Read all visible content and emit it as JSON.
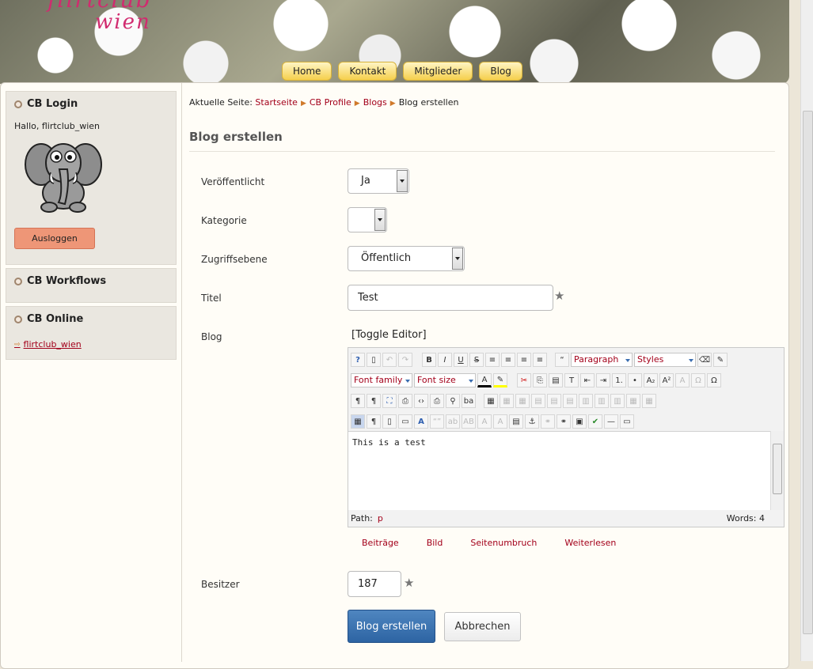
{
  "site": {
    "logo_line1": "flirtclub",
    "logo_line2": "wien"
  },
  "nav": [
    "Home",
    "Kontakt",
    "Mitglieder",
    "Blog"
  ],
  "sidebar": {
    "login_title": "CB Login",
    "greeting": "Hallo, flirtclub_wien",
    "logout_label": "Ausloggen",
    "workflows_title": "CB Workflows",
    "online_title": "CB Online",
    "online_user": "flirtclub_wien"
  },
  "breadcrumb": {
    "prefix": "Aktuelle Seite:",
    "items": [
      "Startseite",
      "CB Profile",
      "Blogs",
      "Blog erstellen"
    ]
  },
  "page_title": "Blog erstellen",
  "form": {
    "published_label": "Veröffentlicht",
    "published_value": "Ja",
    "category_label": "Kategorie",
    "category_value": "",
    "access_label": "Zugriffsebene",
    "access_value": "Öffentlich",
    "title_label": "Titel",
    "title_value": "Test",
    "blog_label": "Blog",
    "toggle_editor": "[Toggle Editor]",
    "owner_label": "Besitzer",
    "owner_value": "187"
  },
  "editor": {
    "format_value": "Paragraph",
    "styles_value": "Styles",
    "font_family": "Font family",
    "font_size": "Font size",
    "content": "This is a test",
    "path_label": "Path:",
    "path_value": "p",
    "words": "Words: 4"
  },
  "editor_buttons": [
    "Beiträge",
    "Bild",
    "Seitenumbruch",
    "Weiterlesen"
  ],
  "actions": {
    "submit": "Blog erstellen",
    "cancel": "Abbrechen"
  }
}
